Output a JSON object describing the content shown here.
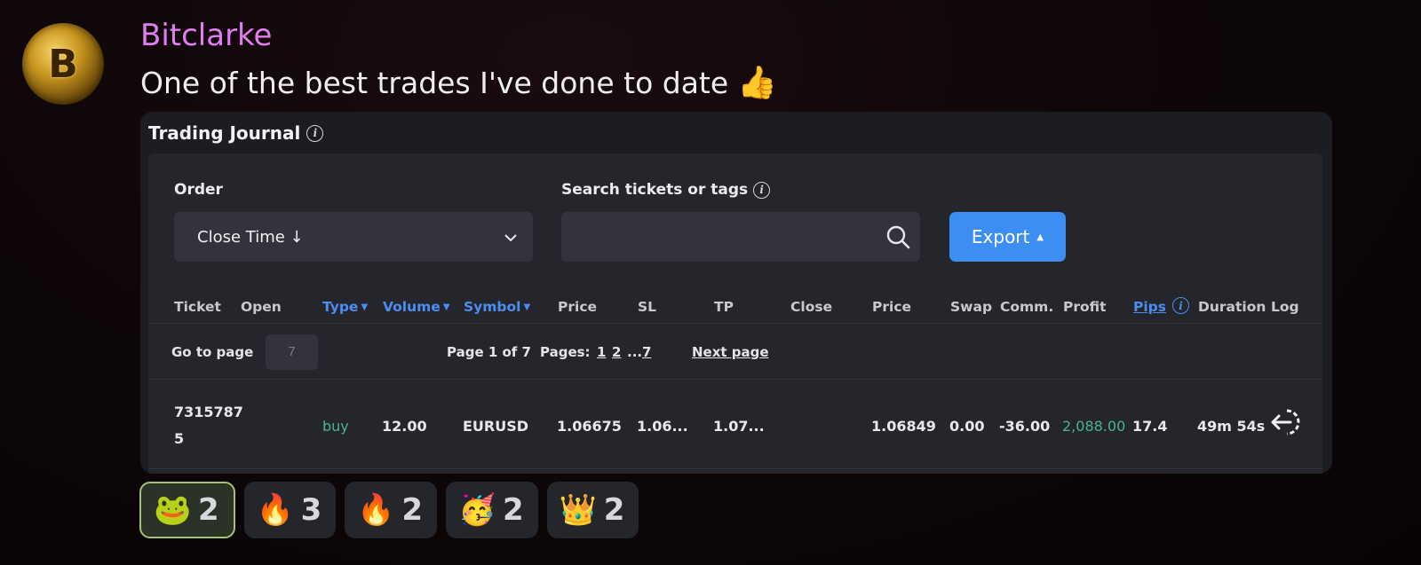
{
  "message": {
    "username": "Bitclarke",
    "text": "One of the best trades I've done to date",
    "emoji": "👍",
    "avatar_glyph": "B",
    "username_color": "#e07df0"
  },
  "journal": {
    "title": "Trading Journal",
    "info_glyph": "i",
    "order_label": "Order",
    "order_value": "Close Time ↓",
    "chevron": "⌄",
    "search_label": "Search tickets or tags",
    "search_placeholder": "",
    "export_label": "Export",
    "export_caret": "▲",
    "accent_color": "#3d8ef2",
    "profit_color": "#49b38d",
    "columns": {
      "ticket": "Ticket",
      "open": "Open",
      "type": "Type",
      "volume": "Volume",
      "symbol": "Symbol",
      "price": "Price",
      "sl": "SL",
      "tp": "TP",
      "close": "Close",
      "close_price": "Price",
      "swap": "Swap",
      "comm": "Comm.",
      "profit": "Profit",
      "pips": "Pips",
      "duration": "Duration",
      "log": "Log"
    },
    "sort_glyph": "▼",
    "pager": {
      "go_to_page": "Go to page",
      "page_input_value": "7",
      "page_of": "Page 1 of 7",
      "pages_label": "Pages:",
      "page_1": "1",
      "page_2": "2",
      "ellipsis": "...",
      "page_7": "7",
      "next_page": "Next page"
    },
    "row": {
      "ticket_line1": "7315787",
      "ticket_line2": "5",
      "type": "buy",
      "volume": "12.00",
      "symbol": "EURUSD",
      "price": "1.06675",
      "sl": "1.06...",
      "tp": "1.07...",
      "close_price": "1.06849",
      "swap": "0.00",
      "comm": "-36.00",
      "profit": "2,088.00",
      "pips": "17.4",
      "duration": "49m 54s"
    }
  },
  "reactions": [
    {
      "emoji": "🐸",
      "count": "2",
      "active": true
    },
    {
      "emoji": "🔥",
      "count": "3",
      "active": false
    },
    {
      "emoji": "🔥",
      "count": "2",
      "active": false
    },
    {
      "emoji": "🥳",
      "count": "2",
      "active": false
    },
    {
      "emoji": "👑",
      "count": "2",
      "active": false
    }
  ]
}
